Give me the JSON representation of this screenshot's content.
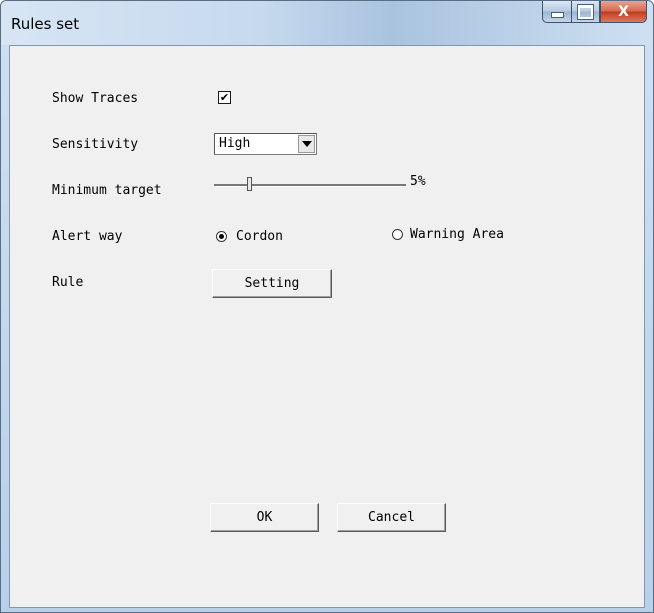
{
  "window": {
    "title": "Rules set",
    "caption_buttons": {
      "minimize": "minimize-icon",
      "maximize": "maximize-icon",
      "close": "X"
    }
  },
  "form": {
    "show_traces": {
      "label": "Show Traces",
      "checked": true,
      "check_mark": "✔"
    },
    "sensitivity": {
      "label": "Sensitivity",
      "value": "High"
    },
    "minimum_target": {
      "label": "Minimum target",
      "value_text": "5%",
      "value": 0.05
    },
    "alert_way": {
      "label": "Alert way",
      "options": [
        {
          "label": "Cordon",
          "selected": true
        },
        {
          "label": "Warning Area",
          "selected": false
        }
      ]
    },
    "rule": {
      "label": "Rule",
      "button_label": "Setting"
    }
  },
  "footer": {
    "ok_label": "OK",
    "cancel_label": "Cancel"
  }
}
